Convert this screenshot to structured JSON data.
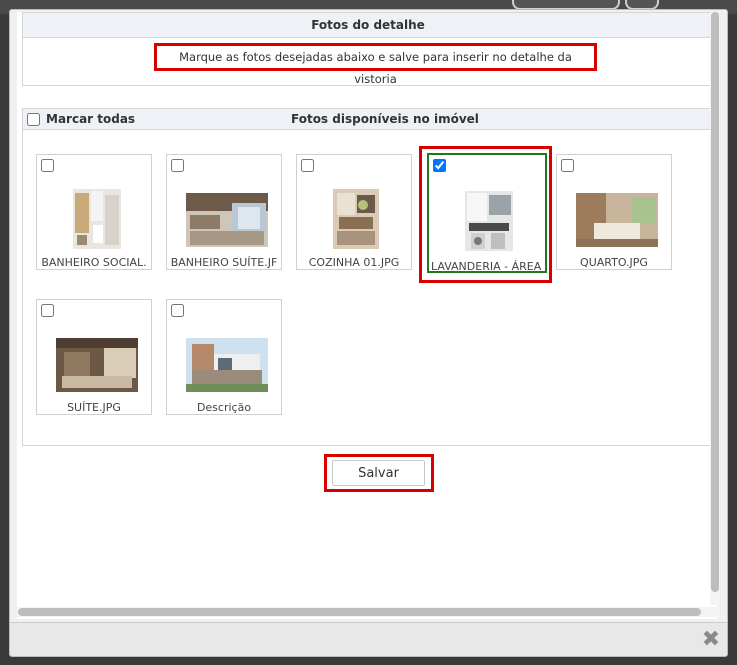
{
  "detail": {
    "title": "Fotos do detalhe",
    "instruction": "Marque as fotos desejadas abaixo e salve para inserir no detalhe da vistoria"
  },
  "photos": {
    "mark_all_label": "Marcar todas",
    "title": "Fotos disponíveis no imóvel",
    "items": [
      {
        "caption": "BANHEIRO SOCIAL.",
        "checked": false,
        "thumb": "bathroom-photo"
      },
      {
        "caption": "BANHEIRO SUÍTE.JF",
        "checked": false,
        "thumb": "suite-bathroom-photo"
      },
      {
        "caption": "COZINHA 01.JPG",
        "checked": false,
        "thumb": "kitchen-photo"
      },
      {
        "caption": "LAVANDERIA - ÁREA",
        "checked": true,
        "thumb": "laundry-photo"
      },
      {
        "caption": "QUARTO.JPG",
        "checked": false,
        "thumb": "bedroom-photo"
      },
      {
        "caption": "SUÍTE.JPG",
        "checked": false,
        "thumb": "suite-photo"
      },
      {
        "caption": "Descrição",
        "checked": false,
        "thumb": "house-facade-photo"
      }
    ]
  },
  "actions": {
    "save_label": "Salvar",
    "close_icon": "close-icon"
  },
  "colors": {
    "highlight": "#d90000",
    "selected_border": "#1e7a1e",
    "header_bg": "#eef2f7"
  }
}
